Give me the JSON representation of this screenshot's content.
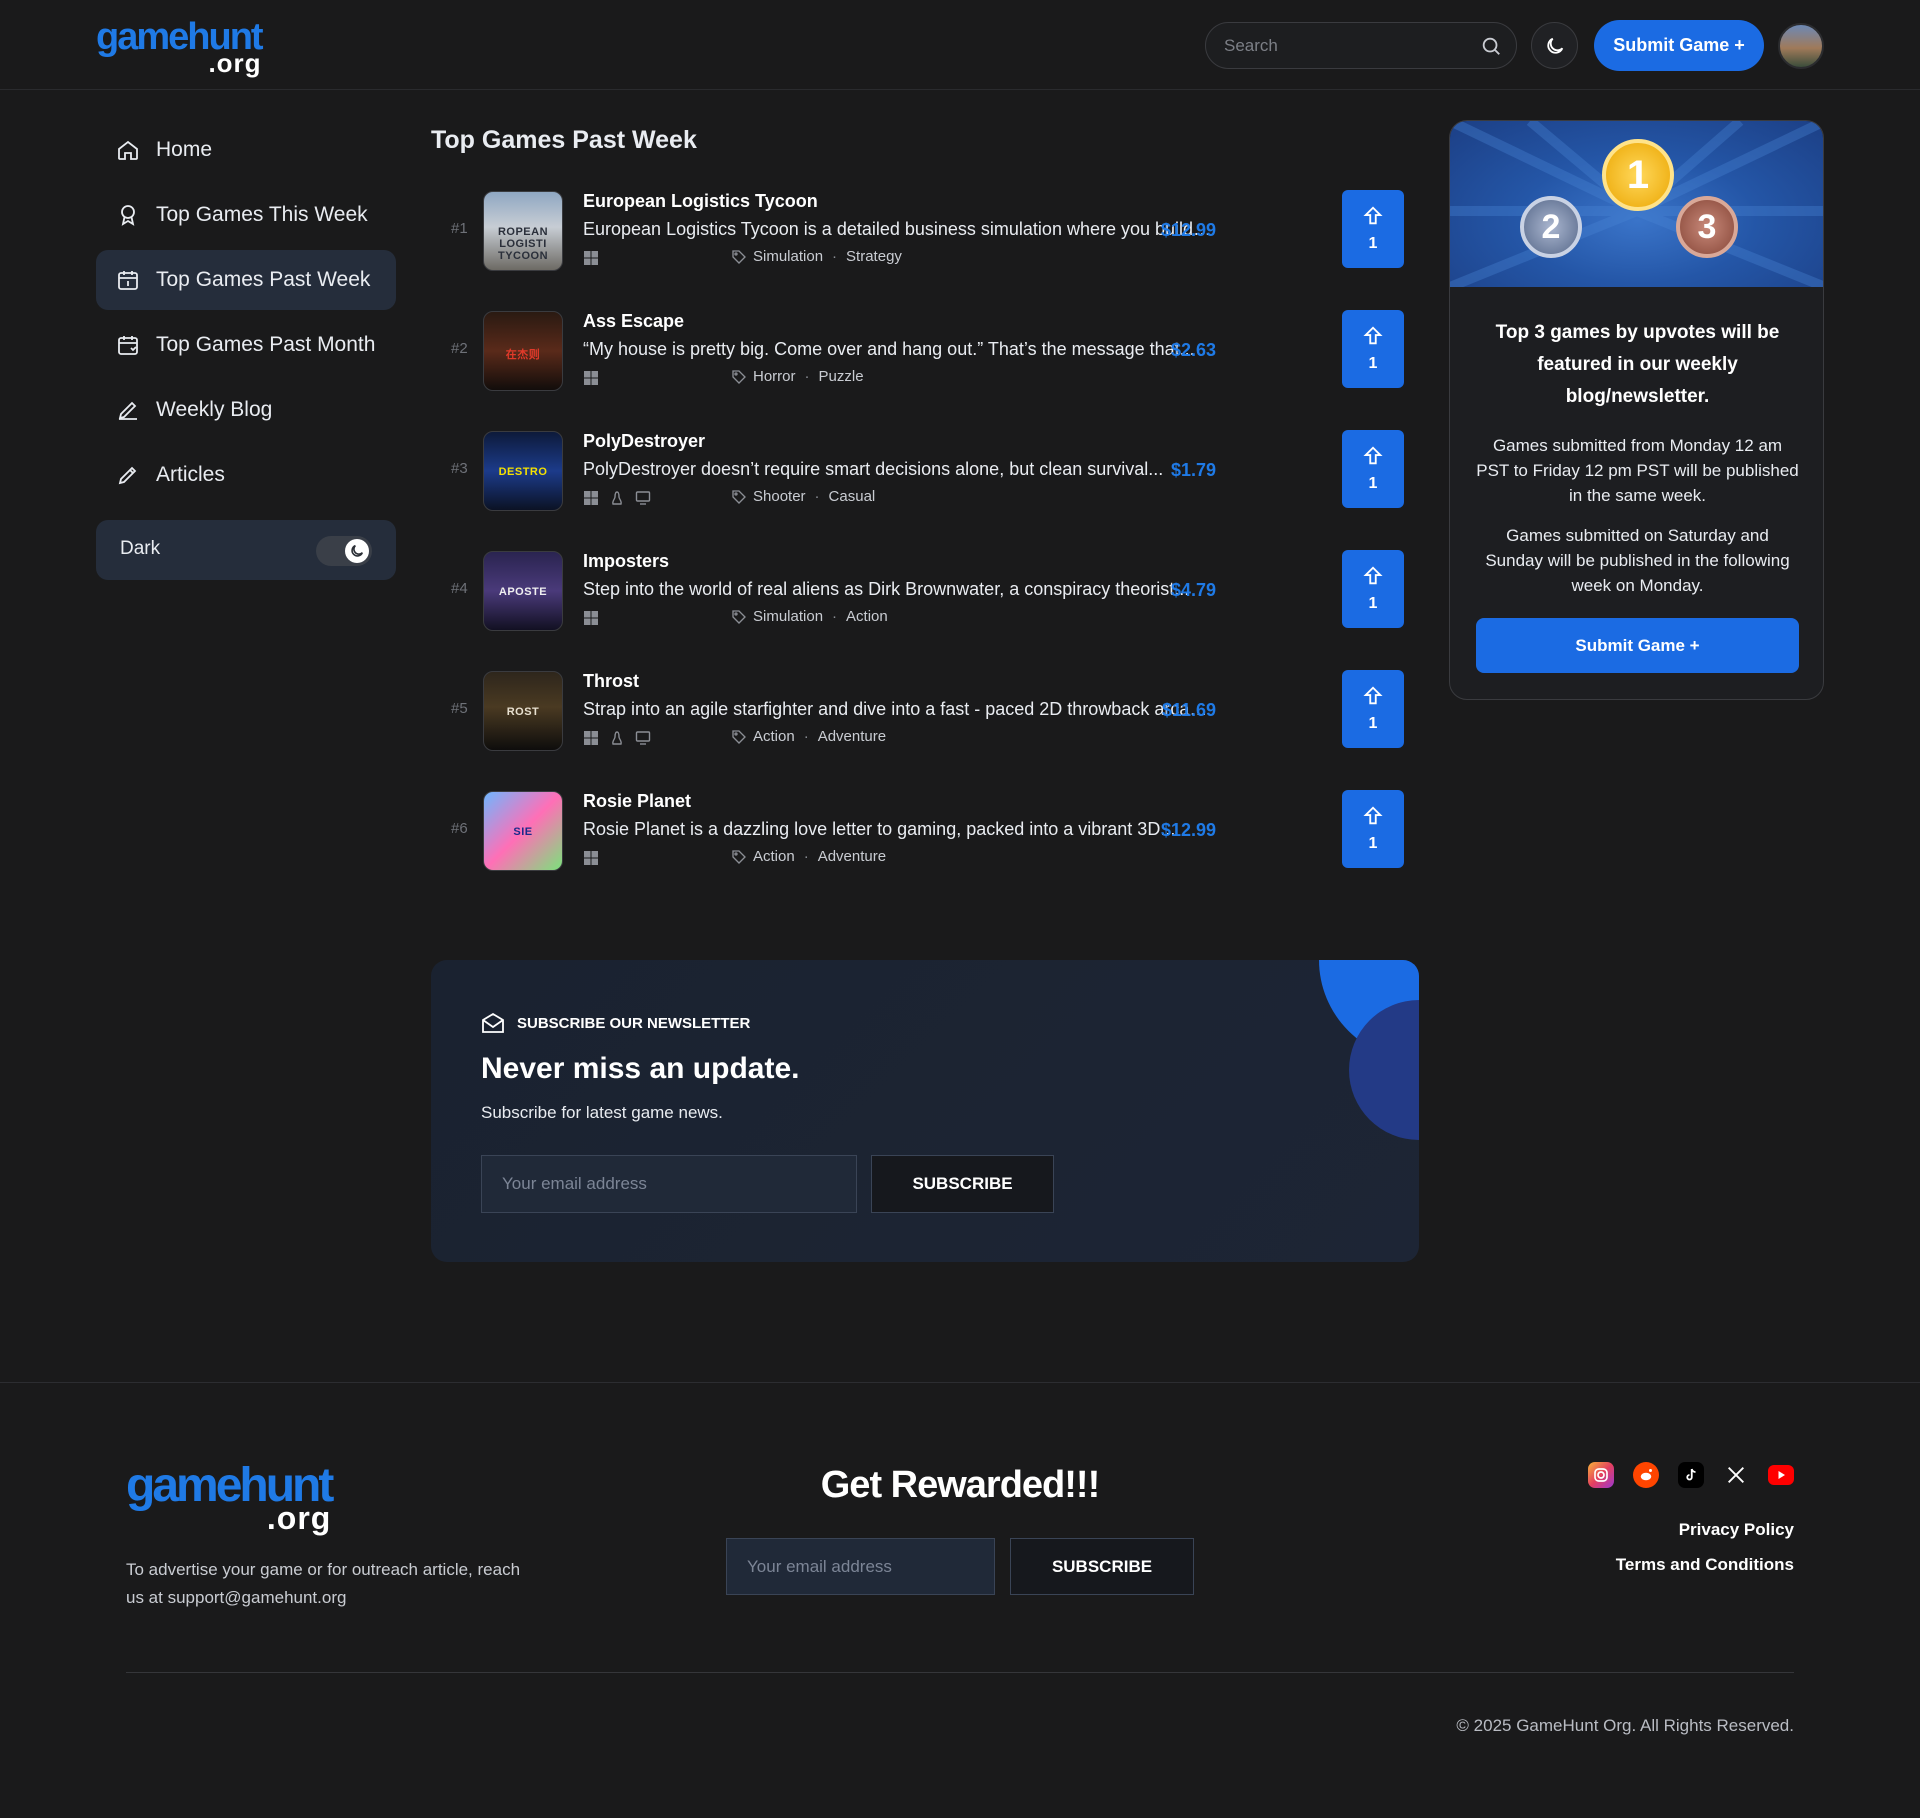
{
  "header": {
    "logo_main": "gamehunt",
    "logo_sub": ".org",
    "search_placeholder": "Search",
    "submit_label": "Submit Game +"
  },
  "sidebar": {
    "items": [
      {
        "label": "Home",
        "icon": "home-icon"
      },
      {
        "label": "Top Games This Week",
        "icon": "award-icon"
      },
      {
        "label": "Top Games Past Week",
        "icon": "calendar-icon",
        "active": true
      },
      {
        "label": "Top Games Past Month",
        "icon": "calendar-check-icon"
      },
      {
        "label": "Weekly Blog",
        "icon": "pen-icon"
      },
      {
        "label": "Articles",
        "icon": "pencil-icon"
      }
    ],
    "theme_toggle_label": "Dark"
  },
  "main": {
    "title": "Top Games Past Week",
    "games": [
      {
        "rank": "#1",
        "name": "European Logistics Tycoon",
        "description": "European Logistics Tycoon is a detailed business simulation where you build ...",
        "tags": [
          "Simulation",
          "Strategy"
        ],
        "price": "$12.99",
        "upvotes": "1",
        "platforms": [
          "windows"
        ],
        "thumb_text": "ROPEAN LOGISTI TYCOON"
      },
      {
        "rank": "#2",
        "name": "Ass Escape",
        "description": "“My house is pretty big. Come over and hang out.” That’s the message that...",
        "tags": [
          "Horror",
          "Puzzle"
        ],
        "price": "$2.63",
        "upvotes": "1",
        "platforms": [
          "windows"
        ],
        "thumb_text": "在杰则"
      },
      {
        "rank": "#3",
        "name": "PolyDestroyer",
        "description": "PolyDestroyer doesn’t require smart decisions alone, but clean survival...",
        "tags": [
          "Shooter",
          "Casual"
        ],
        "price": "$1.79",
        "upvotes": "1",
        "platforms": [
          "windows",
          "linux",
          "mac"
        ],
        "thumb_text": "DESTRO"
      },
      {
        "rank": "#4",
        "name": "Imposters",
        "description": "Step into the world of real aliens as Dirk Brownwater, a conspiracy theorist...",
        "tags": [
          "Simulation",
          "Action"
        ],
        "price": "$4.79",
        "upvotes": "1",
        "platforms": [
          "windows"
        ],
        "thumb_text": "APOSTE"
      },
      {
        "rank": "#5",
        "name": "Throst",
        "description": "Strap into an agile starfighter and dive into a fast - paced 2D throwback arcad...",
        "tags": [
          "Action",
          "Adventure"
        ],
        "price": "$11.69",
        "upvotes": "1",
        "platforms": [
          "windows",
          "linux",
          "mac"
        ],
        "thumb_text": "ROST"
      },
      {
        "rank": "#6",
        "name": "Rosie Planet",
        "description": "Rosie Planet is a dazzling love letter to gaming, packed into a vibrant 3D...",
        "tags": [
          "Action",
          "Adventure"
        ],
        "price": "$12.99",
        "upvotes": "1",
        "platforms": [
          "windows"
        ],
        "thumb_text": "SIE"
      }
    ]
  },
  "newsletter": {
    "eyebrow": "SUBSCRIBE OUR NEWSLETTER",
    "title": "Never miss an update.",
    "text": "Subscribe for latest game news.",
    "email_placeholder": "Your email address",
    "button_label": "SUBSCRIBE"
  },
  "promo": {
    "medals": [
      "1",
      "2",
      "3"
    ],
    "heading": "Top 3 games by upvotes will be featured in our weekly blog/newsletter.",
    "para1": "Games submitted from Monday 12 am PST to Friday 12 pm PST will be published in the same week.",
    "para2": "Games submitted on Saturday and Sunday will be published in the following week on Monday.",
    "button_label": "Submit Game +"
  },
  "footer": {
    "logo_main": "gamehunt",
    "logo_sub": ".org",
    "contact_text": "To advertise your game or for outreach article, reach us at support@gamehunt.org",
    "rewarded_title": "Get Rewarded!!!",
    "email_placeholder": "Your email address",
    "button_label": "SUBSCRIBE",
    "socials": [
      "instagram-icon",
      "reddit-icon",
      "tiktok-icon",
      "x-icon",
      "youtube-icon"
    ],
    "privacy": "Privacy Policy",
    "terms": "Terms and Conditions",
    "copyright": "© 2025 GameHunt Org. All Rights Reserved."
  },
  "colors": {
    "accent": "#1b6be3",
    "price": "#1f7ae6",
    "background": "#1a1a1b",
    "panel": "#1d1e21"
  }
}
